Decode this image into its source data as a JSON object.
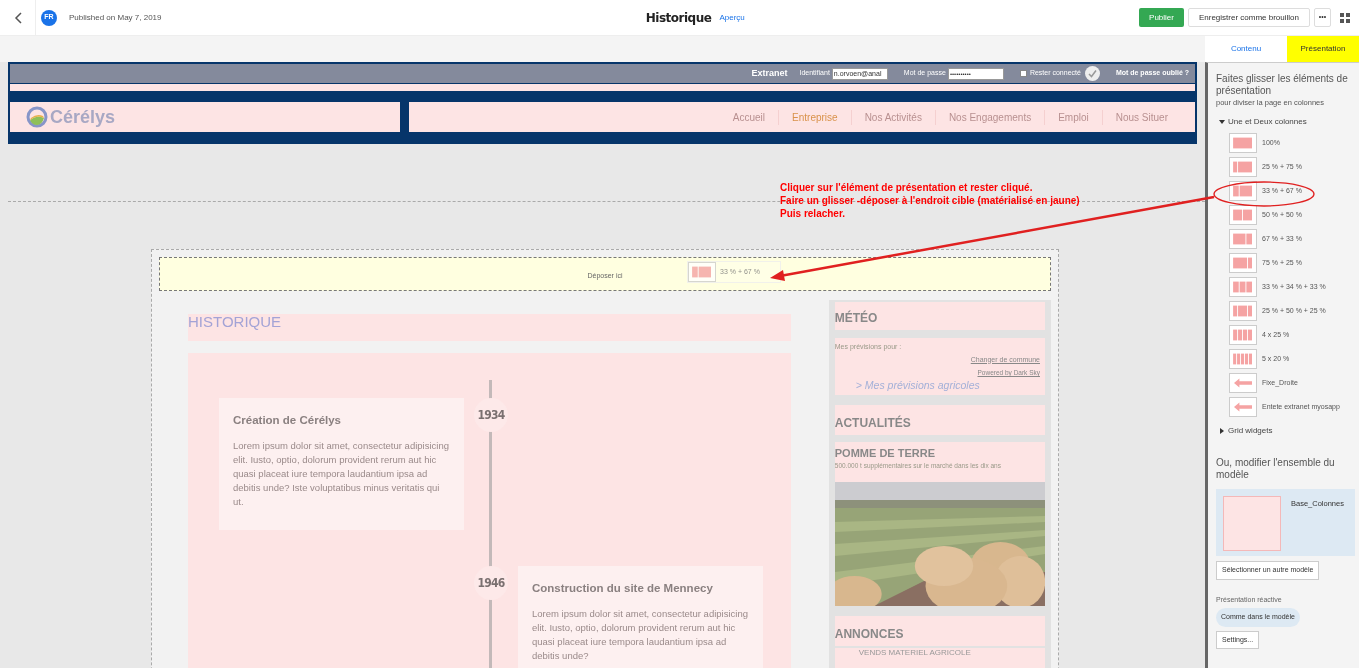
{
  "topbar": {
    "avatar": "FR",
    "published": "Published on May 7, 2019",
    "title": "Historique",
    "preview_link": "Aperçu",
    "publish_button": "Publier",
    "draft_button": "Enregistrer comme brouillon",
    "more_button": "•••"
  },
  "site_header": {
    "extranet": "Extranet",
    "login_label": "Identifiant",
    "login_value": "n.orvoen@anal",
    "password_label": "Mot de passe",
    "password_value": "••••••••••",
    "remember": {
      "label": "Rester connecté",
      "checked": false
    },
    "forgot": "Mot de passe oublié ?",
    "logo": "Cérélys",
    "nav": [
      {
        "label": "Accueil",
        "selected": false
      },
      {
        "label": "Entreprise",
        "selected": true
      },
      {
        "label": "Nos Activités",
        "selected": false
      },
      {
        "label": "Nos Engagements",
        "selected": false
      },
      {
        "label": "Emploi",
        "selected": false
      },
      {
        "label": "Nous Situer",
        "selected": false
      }
    ]
  },
  "annotation": [
    "Cliquer sur l'élément de présentation et rester cliqué.",
    "Faire un glisser -déposer à l'endroit cible (matérialisé en jaune)",
    "Puis relacher."
  ],
  "drop_zone": {
    "label": "Déposer ici",
    "dragged": "33 % + 67 %"
  },
  "page_title": "HISTORIQUE",
  "timeline": [
    {
      "year": "1934",
      "kind": "left",
      "title": "Création de Cérélys",
      "body": "Lorem ipsum dolor sit amet, consectetur adipisicing elit. Iusto, optio, dolorum provident rerum aut hic quasi placeat iure tempora laudantium ipsa ad debitis unde? Iste voluptatibus minus veritatis qui ut."
    },
    {
      "year": "1946",
      "kind": "right",
      "title": "Construction du site de Mennecy",
      "body": "Lorem ipsum dolor sit amet, consectetur adipisicing elit. Iusto, optio, dolorum provident rerum aut hic quasi placeat iure tempora laudantium ipsa ad debitis unde?"
    }
  ],
  "sidebar_widgets": {
    "weather_title": "MÉTÉO",
    "forecast_label": "Mes prévisions pour :",
    "change_link": "Changer de commune",
    "powered": "Powered by Dark Sky",
    "agri_link": "> Mes prévisions agricoles",
    "news_title": "ACTUALITÉS",
    "news_item_title": "POMME DE TERRE",
    "news_item_text": "500.000 t supplémentaires sur le marché dans les dix ans",
    "ads_title": "ANNONCES",
    "ad_item": "VENDS MATERIEL AGRICOLE"
  },
  "panel": {
    "tabs": [
      {
        "label": "Contenu",
        "selected": false
      },
      {
        "label": "Présentation",
        "selected": true
      }
    ],
    "intro": "Faites glisser les éléments de présentation",
    "intro_sub": "pour diviser la page en colonnes",
    "groups": [
      {
        "label": "Une et Deux colonnes",
        "expanded": true,
        "items": [
          {
            "label": "100%",
            "kind": "columns"
          },
          {
            "label": "25 % + 75 %",
            "kind": "columns"
          },
          {
            "label": "33 % + 67 %",
            "kind": "columns"
          },
          {
            "label": "50 % + 50 %",
            "kind": "columns"
          },
          {
            "label": "67 % + 33 %",
            "kind": "columns"
          },
          {
            "label": "75 % + 25 %",
            "kind": "columns"
          },
          {
            "label": "33 % + 34 % + 33 %",
            "kind": "columns"
          },
          {
            "label": "25 % + 50 % + 25 %",
            "kind": "columns"
          },
          {
            "label": "4 x 25 %",
            "kind": "columns"
          },
          {
            "label": "5 x 20 %",
            "kind": "columns"
          },
          {
            "label": "Fixe_Droite",
            "kind": "arrow"
          },
          {
            "label": "Entete extranet myosapp",
            "kind": "arrow"
          }
        ]
      },
      {
        "label": "Grid widgets",
        "expanded": false
      }
    ],
    "model_heading": "Ou, modifier l'ensemble du modèle",
    "model_name": "Base_Colonnes",
    "select_model_button": "Sélectionner un autre modèle",
    "responsive_label": "Présentation réactive",
    "responsive_value": "Comme dans le modèle",
    "settings_button": "Settings..."
  }
}
